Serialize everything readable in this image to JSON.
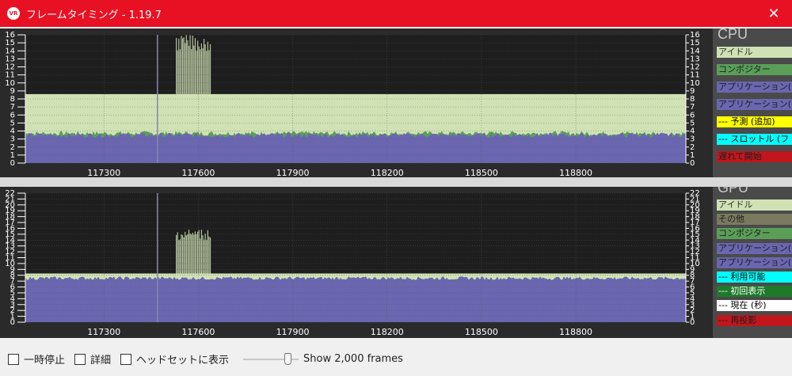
{
  "window": {
    "title": "フレームタイミング - 1.19.7",
    "app_icon_text": "VR",
    "close_glyph": "✕"
  },
  "cpu": {
    "title": "CPU",
    "y_ticks": [
      "0",
      "1",
      "2",
      "3",
      "4",
      "5",
      "6",
      "7",
      "8",
      "9",
      "10",
      "11",
      "12",
      "13",
      "14",
      "15",
      "16"
    ],
    "y_max": 16,
    "x_ticks": [
      "117300",
      "117600",
      "117900",
      "118200",
      "118500",
      "118800"
    ],
    "x_range": [
      117050,
      119150
    ],
    "legend": [
      {
        "label": "アイドル",
        "bg": "#d0e1b4",
        "fg": "#333333"
      },
      {
        "label": "コンポジター",
        "bg": "#5a9e58",
        "fg": "#1e1e1e"
      },
      {
        "label": "アプリケーション(モ",
        "bg": "#6a66b0",
        "fg": "#1e1e1e"
      },
      {
        "label": "アプリケーション(モ",
        "bg": "#6a66b0",
        "fg": "#1e1e1e"
      },
      {
        "label": "--- 予測 (追加)",
        "bg": "#ffff00",
        "fg": "#000000"
      },
      {
        "label": "--- スロットル (フ",
        "bg": "#00ffff",
        "fg": "#000000"
      },
      {
        "label": "遅れて開始",
        "bg": "#c0161c",
        "fg": "#1e1e1e"
      }
    ],
    "series": [
      {
        "name": "アイドル",
        "color": "#d0e1b4",
        "level": 8.6
      },
      {
        "name": "コンポジター",
        "color": "#5a9e58",
        "level": 3.7
      },
      {
        "name": "アプリケーション",
        "color": "#6a66b0",
        "level": 3.5
      }
    ],
    "spike_frame": 117470,
    "burst": {
      "from": 117530,
      "to": 117640,
      "value": 16
    }
  },
  "gpu": {
    "title": "GPU",
    "y_ticks": [
      "0",
      "1",
      "2",
      "3",
      "4",
      "5",
      "6",
      "7",
      "8",
      "9",
      "10",
      "11",
      "12",
      "13",
      "14",
      "15",
      "16",
      "17",
      "18",
      "19",
      "20",
      "21",
      "22"
    ],
    "y_max": 22,
    "x_ticks": [
      "117300",
      "117600",
      "117900",
      "118200",
      "118500",
      "118800"
    ],
    "x_range": [
      117050,
      119150
    ],
    "legend": [
      {
        "label": "アイドル",
        "bg": "#d0e1b4",
        "fg": "#333333"
      },
      {
        "label": "その他",
        "bg": "#7a7a60",
        "fg": "#1e1e1e"
      },
      {
        "label": "コンポジター",
        "bg": "#5a9e58",
        "fg": "#1e1e1e"
      },
      {
        "label": "アプリケーション(モ",
        "bg": "#6a66b0",
        "fg": "#1e1e1e"
      },
      {
        "label": "アプリケーション(モ",
        "bg": "#6a66b0",
        "fg": "#1e1e1e"
      },
      {
        "label": "--- 利用可能",
        "bg": "#00ffff",
        "fg": "#000000"
      },
      {
        "label": "--- 初回表示",
        "bg": "#1e7a2a",
        "fg": "#ffffff"
      },
      {
        "label": "--- 現在 (秒)",
        "bg": "#ffffff",
        "fg": "#000000"
      },
      {
        "label": "--- 再投影",
        "bg": "#c0161c",
        "fg": "#1e1e1e"
      }
    ],
    "series": [
      {
        "name": "アイドル",
        "color": "#d0e1b4",
        "level": 8.3
      },
      {
        "name": "アプリケーション",
        "color": "#6a66b0",
        "level": 7.5
      }
    ],
    "spike_frame": 117470,
    "burst": {
      "from": 117530,
      "to": 117640,
      "value": 16
    }
  },
  "controls": {
    "pause_label": "一時停止",
    "details_label": "詳細",
    "headset_label": "ヘッドセットに表示",
    "frames_label": "Show 2,000 frames",
    "frames_slider_fraction": 0.85
  },
  "colors": {
    "plot_bg": "#1e1e1e",
    "grid": "#555555",
    "axis_text": "#ffffff"
  }
}
